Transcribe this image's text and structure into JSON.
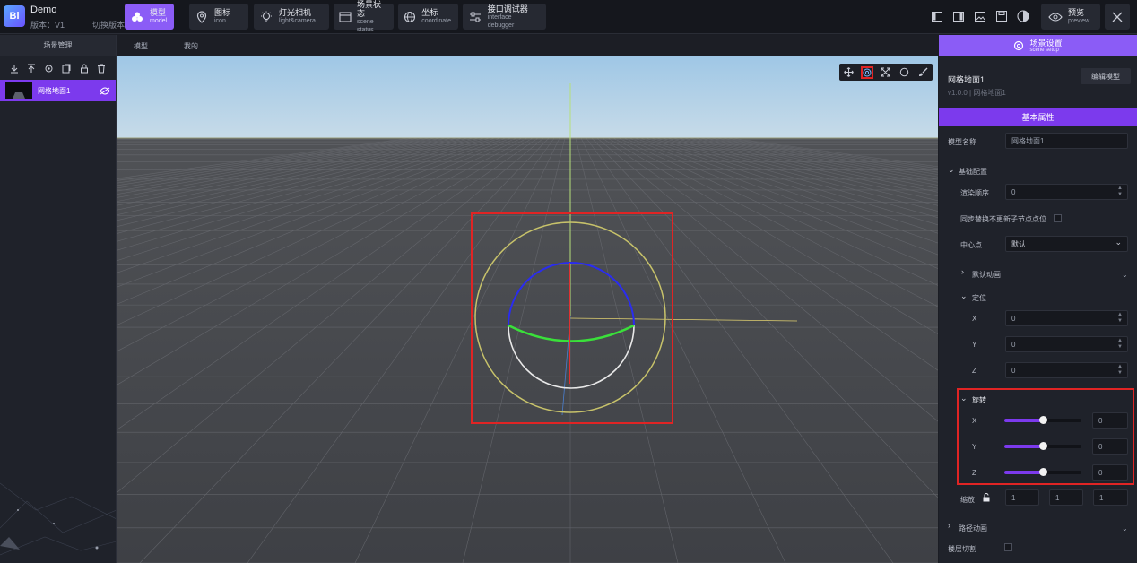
{
  "app": {
    "logo": "Bi",
    "name": "Demo",
    "version": "版本：V1",
    "switch_version": "切换版本"
  },
  "nav": [
    {
      "label": "模型",
      "sub": "model",
      "icon": "model-icon"
    },
    {
      "label": "图标",
      "sub": "icon",
      "icon": "map-pin-icon"
    },
    {
      "label": "灯光相机",
      "sub": "light&camera",
      "icon": "lightbulb-icon"
    },
    {
      "label": "场景状态",
      "sub": "scene status",
      "icon": "scene-window-icon"
    },
    {
      "label": "坐标",
      "sub": "coordinate",
      "icon": "globe-icon"
    },
    {
      "label": "接口调试器",
      "sub": "interface debugger",
      "icon": "sliders-icon"
    }
  ],
  "preview": {
    "label": "预览",
    "sub": "preview"
  },
  "left_panel": {
    "header": "场景管理",
    "item_label": "网格地面1"
  },
  "viewport_tabs": [
    "模型",
    "我的"
  ],
  "right_panel": {
    "setup_label": "场景设置",
    "setup_sub": "scene setup",
    "title": "网格地面1",
    "subtitle": "v1.0.0 | 网格地面1",
    "edit_button": "编辑模型",
    "section": "基本属性",
    "model_name_label": "模型名称",
    "model_name_value": "网格地面1",
    "basic_config": "基础配置",
    "render_order_label": "渲染顺序",
    "render_order_value": "0",
    "sync_label": "同步替换不更新子节点点位",
    "center_label": "中心点",
    "center_value": "默认",
    "default_anim": "默认动画",
    "position": "定位",
    "pos": [
      {
        "axis": "X",
        "value": "0"
      },
      {
        "axis": "Y",
        "value": "0"
      },
      {
        "axis": "Z",
        "value": "0"
      }
    ],
    "rotation": "旋转",
    "rot": [
      {
        "axis": "X",
        "value": "0",
        "level": 0.5
      },
      {
        "axis": "Y",
        "value": "0",
        "level": 0.5
      },
      {
        "axis": "Z",
        "value": "0",
        "level": 0.5
      }
    ],
    "scale_label": "缩放",
    "scale": [
      "1",
      "1",
      "1"
    ],
    "path_anim": "路径动画",
    "layer_cut": "楼层切割"
  },
  "colors": {
    "accent": "#8b5cf6",
    "highlight": "#e02424"
  }
}
